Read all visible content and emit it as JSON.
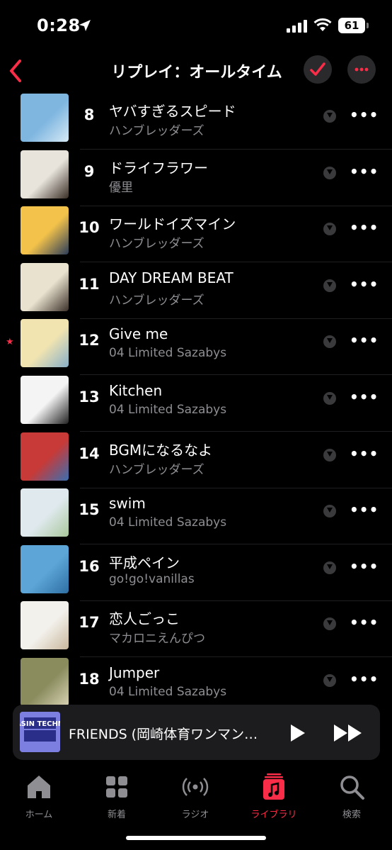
{
  "status": {
    "time": "0:28",
    "battery": "61"
  },
  "nav": {
    "title": "リプレイ：オールタイム"
  },
  "songs": [
    {
      "num": "8",
      "title": "ヤバすぎるスピード",
      "artist": "ハンブレッダーズ"
    },
    {
      "num": "9",
      "title": "ドライフラワー",
      "artist": "優里"
    },
    {
      "num": "10",
      "title": "ワールドイズマイン",
      "artist": "ハンブレッダーズ"
    },
    {
      "num": "11",
      "title": "DAY DREAM BEAT",
      "artist": "ハンブレッダーズ"
    },
    {
      "num": "12",
      "title": "Give me",
      "artist": "04 Limited Sazabys",
      "starred": true
    },
    {
      "num": "13",
      "title": "Kitchen",
      "artist": "04 Limited Sazabys"
    },
    {
      "num": "14",
      "title": "BGMになるなよ",
      "artist": "ハンブレッダーズ"
    },
    {
      "num": "15",
      "title": "swim",
      "artist": "04 Limited Sazabys"
    },
    {
      "num": "16",
      "title": "平成ペイン",
      "artist": "go!go!vanillas"
    },
    {
      "num": "17",
      "title": "恋人ごっこ",
      "artist": "マカロニえんぴつ"
    },
    {
      "num": "18",
      "title": "Jumper",
      "artist": "04 Limited Sazabys"
    }
  ],
  "player": {
    "title": "FRIENDS (岡崎体育ワンマン…",
    "art_text": "BASIN TECHNO"
  },
  "tabs": [
    {
      "label": "ホーム",
      "icon": "home-icon"
    },
    {
      "label": "新着",
      "icon": "grid-icon"
    },
    {
      "label": "ラジオ",
      "icon": "radio-icon"
    },
    {
      "label": "ライブラリ",
      "icon": "library-icon",
      "active": true
    },
    {
      "label": "検索",
      "icon": "search-icon"
    }
  ],
  "colors": {
    "accent": "#fa2d48",
    "background": "#000000",
    "secondary_text": "#8e8e93"
  }
}
